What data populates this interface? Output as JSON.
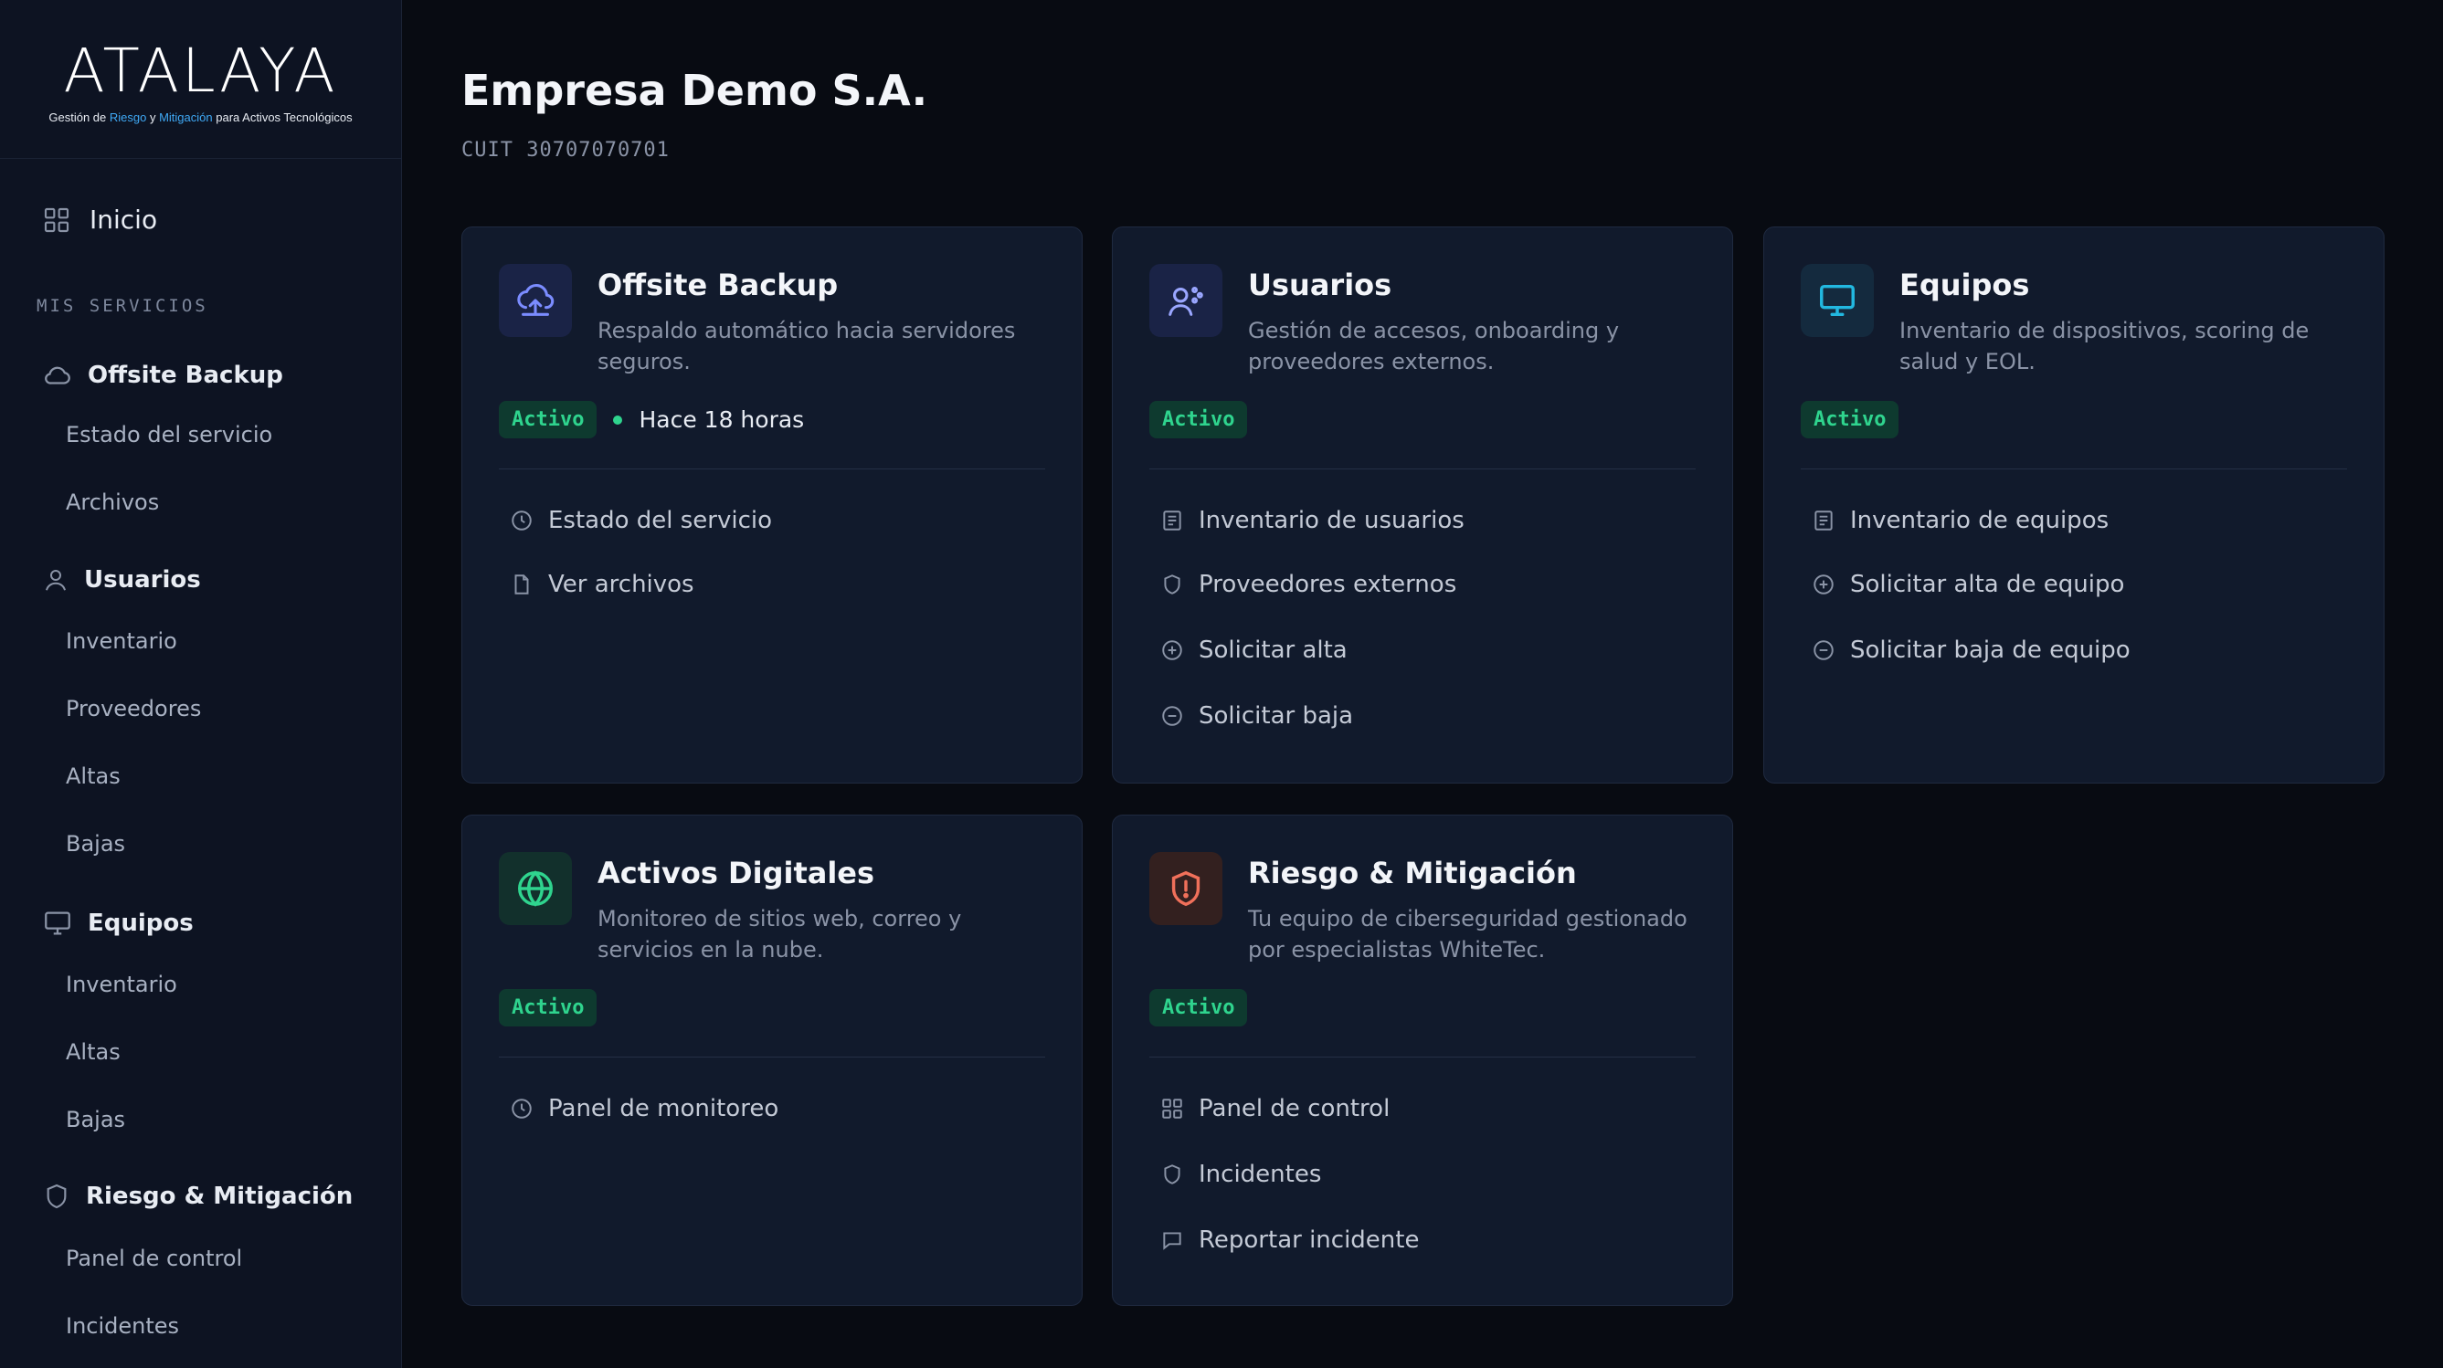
{
  "brand": {
    "name": "ATALAYA",
    "tagline_parts": [
      "Gestión de ",
      "Riesgo",
      " y ",
      "Mitigación",
      " para Activos Tecnológicos"
    ],
    "accent": "#3fa9f5"
  },
  "sidebar": {
    "home_label": "Inicio",
    "section_label": "MIS SERVICIOS",
    "groups": [
      {
        "label": "Offsite Backup",
        "icon": "cloud-icon",
        "items": [
          "Estado del servicio",
          "Archivos"
        ]
      },
      {
        "label": "Usuarios",
        "icon": "user-icon",
        "items": [
          "Inventario",
          "Proveedores",
          "Altas",
          "Bajas"
        ]
      },
      {
        "label": "Equipos",
        "icon": "monitor-icon",
        "items": [
          "Inventario",
          "Altas",
          "Bajas"
        ]
      },
      {
        "label": "Riesgo & Mitigación",
        "icon": "shield-icon",
        "items": [
          "Panel de control",
          "Incidentes"
        ]
      }
    ]
  },
  "header": {
    "title": "Empresa Demo S.A.",
    "cuit": "CUIT 30707070701"
  },
  "cards": [
    {
      "title": "Offsite Backup",
      "description": "Respaldo automático hacia servidores seguros.",
      "status": "Activo",
      "last_update": "Hace 18 horas",
      "icon": "cloud-upload-icon",
      "links": [
        {
          "label": "Estado del servicio",
          "icon": "clock-icon"
        },
        {
          "label": "Ver archivos",
          "icon": "file-icon"
        }
      ]
    },
    {
      "title": "Usuarios",
      "description": "Gestión de accesos, onboarding y proveedores externos.",
      "status": "Activo",
      "icon": "users-icon",
      "links": [
        {
          "label": "Inventario de usuarios",
          "icon": "list-icon"
        },
        {
          "label": "Proveedores externos",
          "icon": "shield-icon"
        },
        {
          "label": "Solicitar alta",
          "icon": "plus-circle-icon"
        },
        {
          "label": "Solicitar baja",
          "icon": "minus-circle-icon"
        }
      ]
    },
    {
      "title": "Equipos",
      "description": "Inventario de dispositivos, scoring de salud y EOL.",
      "status": "Activo",
      "icon": "monitor-icon",
      "links": [
        {
          "label": "Inventario de equipos",
          "icon": "list-icon"
        },
        {
          "label": "Solicitar alta de equipo",
          "icon": "plus-circle-icon"
        },
        {
          "label": "Solicitar baja de equipo",
          "icon": "minus-circle-icon"
        }
      ]
    },
    {
      "title": "Activos Digitales",
      "description": "Monitoreo de sitios web, correo y servicios en la nube.",
      "status": "Activo",
      "icon": "globe-icon",
      "links": [
        {
          "label": "Panel de monitoreo",
          "icon": "clock-icon"
        }
      ]
    },
    {
      "title": "Riesgo & Mitigación",
      "description": "Tu equipo de ciberseguridad gestionado por especialistas WhiteTec.",
      "status": "Activo",
      "icon": "shield-alert-icon",
      "links": [
        {
          "label": "Panel de control",
          "icon": "grid-icon"
        },
        {
          "label": "Incidentes",
          "icon": "shield-icon"
        },
        {
          "label": "Reportar incidente",
          "icon": "message-icon"
        }
      ]
    }
  ],
  "colors": {
    "background": "#080b12",
    "sidebar": "#0d1322",
    "card": "#111a2c",
    "status_green": "#2fd48e",
    "icon_blue": "#7b8cff",
    "icon_cyan": "#22b8e0",
    "icon_green": "#2fd48e",
    "icon_red": "#f0705a"
  }
}
